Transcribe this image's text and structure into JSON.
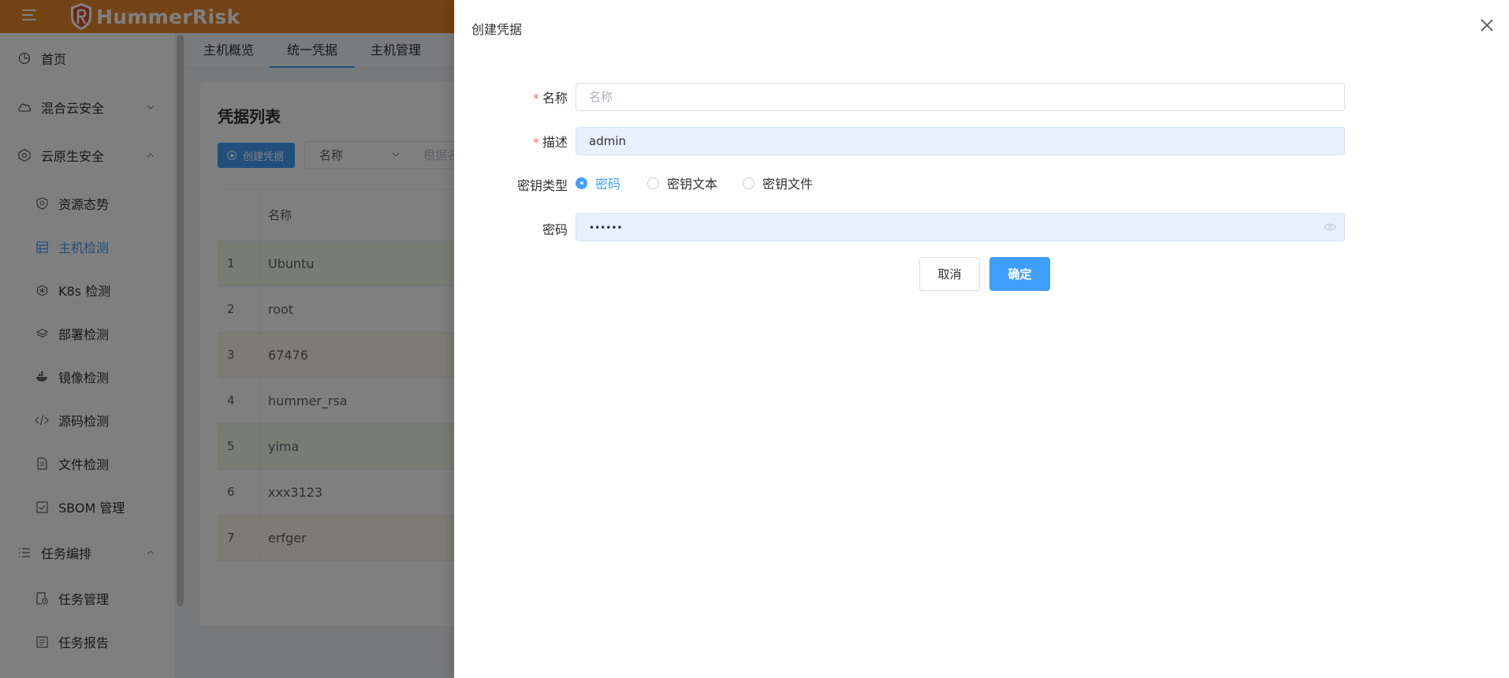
{
  "app": {
    "logo_text": "HummerRisk"
  },
  "sidebar": {
    "items": [
      {
        "label": "首页",
        "icon": "dashboard-icon"
      },
      {
        "label": "混合云安全",
        "icon": "cloud-icon"
      },
      {
        "label": "云原生安全",
        "icon": "cloud-native-icon"
      },
      {
        "label": "资源态势",
        "icon": "shield-icon"
      },
      {
        "label": "主机检测",
        "icon": "host-icon"
      },
      {
        "label": "K8s 检测",
        "icon": "k8s-icon"
      },
      {
        "label": "部署检测",
        "icon": "layers-icon"
      },
      {
        "label": "镜像检测",
        "icon": "image-icon"
      },
      {
        "label": "源码检测",
        "icon": "code-icon"
      },
      {
        "label": "文件检测",
        "icon": "file-icon"
      },
      {
        "label": "SBOM 管理",
        "icon": "checkbox-icon"
      },
      {
        "label": "任务编排",
        "icon": "list-icon"
      },
      {
        "label": "任务管理",
        "icon": "task-icon"
      },
      {
        "label": "任务报告",
        "icon": "report-icon"
      }
    ]
  },
  "tabs": [
    "主机概览",
    "统一凭据",
    "主机管理"
  ],
  "credentials": {
    "title": "凭据列表",
    "create_button": "创建凭据",
    "filter_field": "名称",
    "filter_placeholder": "根据名",
    "column_name": "名称",
    "rows": [
      {
        "index": "1",
        "name": "Ubuntu"
      },
      {
        "index": "2",
        "name": "root"
      },
      {
        "index": "3",
        "name": "67476"
      },
      {
        "index": "4",
        "name": "hummer_rsa"
      },
      {
        "index": "5",
        "name": "yima"
      },
      {
        "index": "6",
        "name": "xxx3123"
      },
      {
        "index": "7",
        "name": "erfger"
      }
    ],
    "row_colors": [
      "#f0f9eb",
      "#ffffff",
      "#fdf6ec",
      "#ffffff",
      "#f0f9eb",
      "#ffffff",
      "#fdf6ec"
    ]
  },
  "drawer": {
    "title": "创建凭据",
    "name_label": "名称",
    "name_placeholder": "名称",
    "desc_label": "描述",
    "desc_value": "admin",
    "key_type_label": "密钥类型",
    "key_types": [
      "密码",
      "密钥文本",
      "密钥文件"
    ],
    "selected_key_type": "密码",
    "password_label": "密码",
    "password_value": "••••••",
    "cancel_button": "取消",
    "confirm_button": "确定"
  },
  "colors": {
    "topbar": "#e8862a",
    "primary": "#409eff",
    "required": "#f56c6c"
  }
}
